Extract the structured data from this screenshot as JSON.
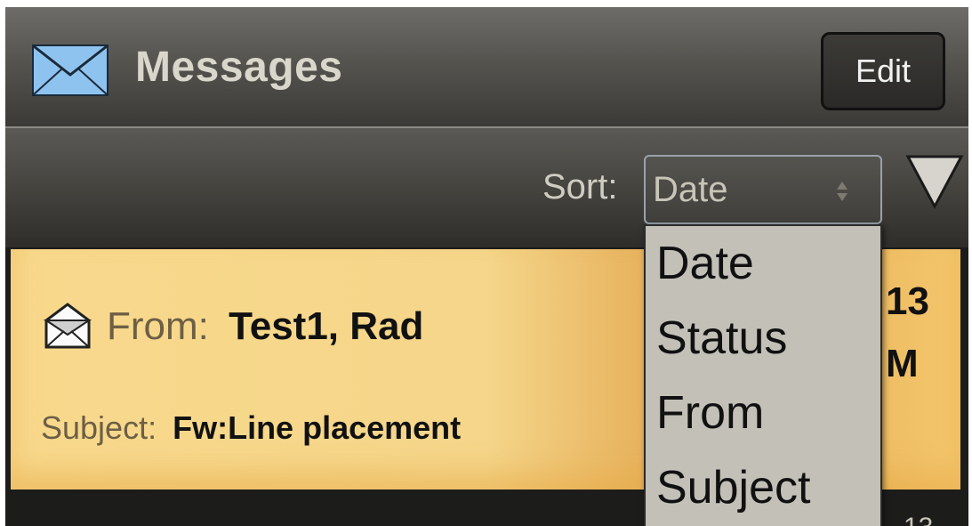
{
  "header": {
    "title": "Messages",
    "edit_label": "Edit"
  },
  "sort": {
    "label": "Sort:",
    "selected": "Date",
    "options": [
      "Date",
      "Status",
      "From",
      "Subject"
    ]
  },
  "message": {
    "from_label": "From:",
    "from_name": "Test1, Rad",
    "subject_label": "Subject:",
    "subject": "Fw:Line placement",
    "date_partial": "13",
    "time_partial": "M"
  },
  "next_row_partial": "13",
  "icons": {
    "app": "envelope-icon",
    "message": "open-envelope-icon",
    "select": "select-arrows-icon",
    "collapse": "triangle-down-icon"
  },
  "colors": {
    "header": "#55544f",
    "row_highlight": "#f5d68a",
    "dropdown": "#c2c0b7"
  }
}
